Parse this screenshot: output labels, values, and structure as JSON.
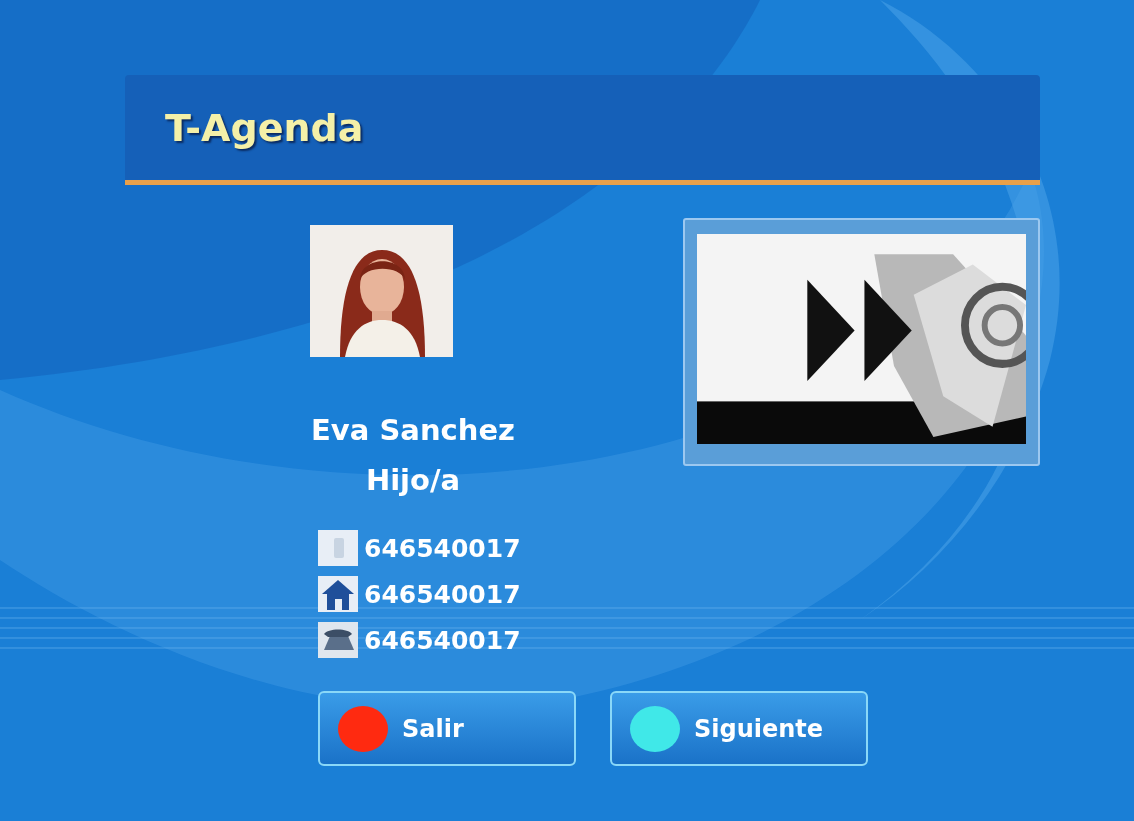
{
  "header": {
    "title": "T-Agenda"
  },
  "contact": {
    "name": "Eva Sanchez",
    "relation": "Hijo/a",
    "phones": [
      {
        "kind": "mobile",
        "number": "646540017"
      },
      {
        "kind": "home",
        "number": "646540017"
      },
      {
        "kind": "work",
        "number": "646540017"
      }
    ]
  },
  "buttons": [
    {
      "label": "Salir",
      "color": "#ff2a10"
    },
    {
      "label": "Siguiente",
      "color": "#40e8e8"
    }
  ]
}
